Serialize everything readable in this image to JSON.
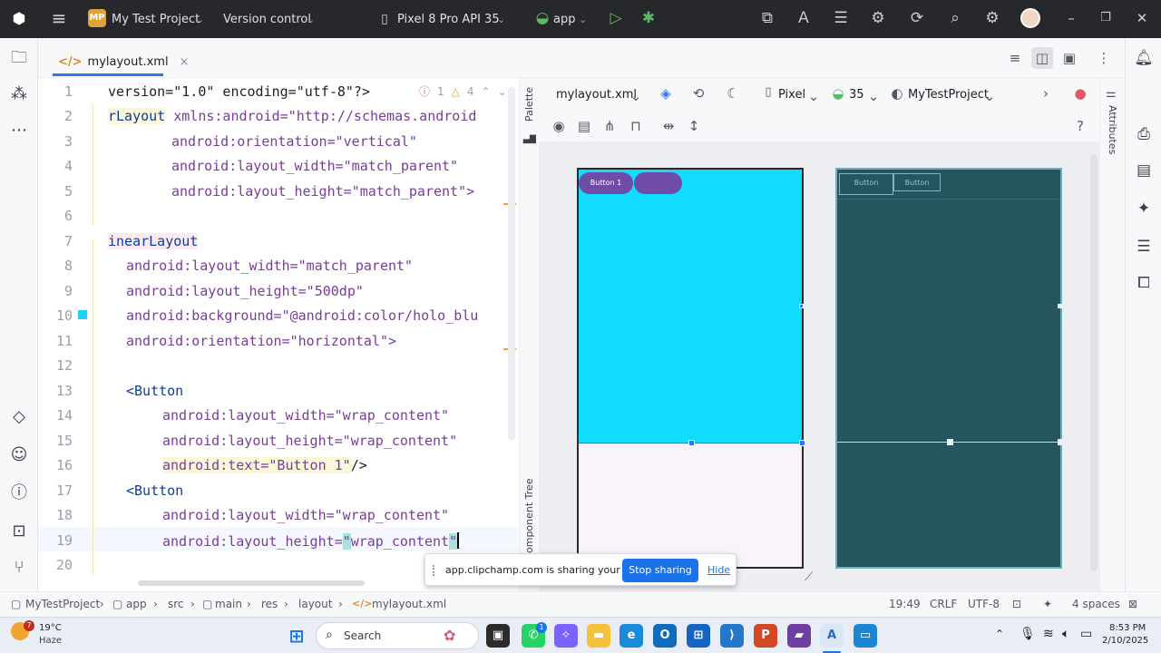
{
  "titlebar": {
    "project_badge": "MP",
    "project_name": "My Test Project",
    "vcs": "Version control",
    "device": "Pixel 8 Pro API 35",
    "run_config": "app"
  },
  "editor_tab": {
    "filename": "mylayout.xml",
    "close_glyph": "×"
  },
  "editor": {
    "error_count": "1",
    "warning_count": "4",
    "line_numbers": [
      "1",
      "2",
      "3",
      "4",
      "5",
      "6",
      "7",
      "8",
      "9",
      "10",
      "11",
      "12",
      "13",
      "14",
      "15",
      "16",
      "17",
      "18",
      "19",
      "20"
    ],
    "lines": {
      "l1": "version=\"1.0\" encoding=\"utf-8\"?>",
      "l2a": "rLayout",
      "l2b": " xmlns:android=\"http://schemas.android",
      "l3": "android:orientation=\"vertical\"",
      "l4": "android:layout_width=\"match_parent\"",
      "l5": "android:layout_height=\"match_parent\">",
      "l7": "inearLayout",
      "l8": "android:layout_width=\"match_parent\"",
      "l9": "android:layout_height=\"500dp\"",
      "l10": "android:background=\"@android:color/holo_blu",
      "l11": "android:orientation=\"horizontal\">",
      "l13": "<Button",
      "l14": "android:layout_width=\"wrap_content\"",
      "l15": "android:layout_height=\"wrap_content\"",
      "l16a": "android:text=\"Button 1\"",
      "l16b": "/>",
      "l17": "<Button",
      "l18": "android:layout_width=\"wrap_content\"",
      "l19a": "android:layout_height=",
      "l19b": "\"",
      "l19c": "wrap_content",
      "l19d": "\""
    }
  },
  "side_labels": {
    "palette": "Palette",
    "component_tree": "omponent Tree",
    "attributes": "Attributes"
  },
  "design_toolbar": {
    "file": "mylayout.xml",
    "device": "Pixel",
    "api": "35",
    "theme": "MyTestProject",
    "help": "?"
  },
  "preview": {
    "button1_label": "Button 1",
    "blueprint_btn1": "Button",
    "blueprint_btn2": "Button",
    "background_color": "#12DCFD",
    "button_color": "#6F4CA8",
    "blueprint_color": "#25565F"
  },
  "share_banner": {
    "message": "app.clipchamp.com is sharing your screen.",
    "stop": "Stop sharing",
    "hide": "Hide"
  },
  "statusbar": {
    "breadcrumb": [
      "MyTestProject",
      "app",
      "src",
      "main",
      "res",
      "layout",
      "mylayout.xml"
    ],
    "position": "19:49",
    "line_sep": "CRLF",
    "encoding": "UTF-8",
    "indent": "4 spaces"
  },
  "taskbar": {
    "temperature": "19°C",
    "weather": "Haze",
    "weather_badge": "7",
    "search_label": "Search",
    "whatsapp_badge": "1",
    "time": "8:53 PM",
    "date": "2/10/2025"
  }
}
